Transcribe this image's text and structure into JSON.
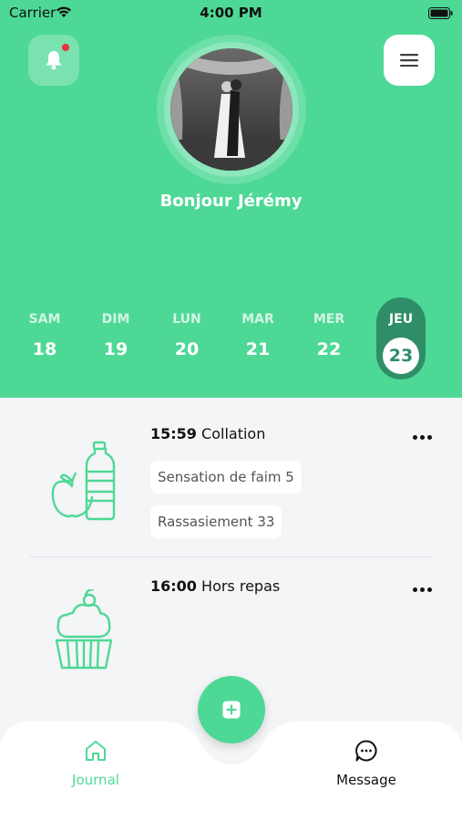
{
  "status": {
    "carrier": "Carrier",
    "time": "4:00 PM"
  },
  "header": {
    "greeting": "Bonjour Jérémy"
  },
  "days": [
    {
      "name": "SAM",
      "num": "18"
    },
    {
      "name": "DIM",
      "num": "19"
    },
    {
      "name": "LUN",
      "num": "20"
    },
    {
      "name": "MAR",
      "num": "21"
    },
    {
      "name": "MER",
      "num": "22"
    },
    {
      "name": "JEU",
      "num": "23"
    }
  ],
  "entries": [
    {
      "time": "15:59",
      "title": "Collation",
      "tags": [
        "Sensation de faim 5",
        "Rassasiement 33"
      ],
      "icon": "apple-bottle-icon"
    },
    {
      "time": "16:00",
      "title": "Hors repas",
      "tags": [],
      "icon": "cupcake-icon"
    }
  ],
  "tabbar": {
    "journal_label": "Journal",
    "message_label": "Message"
  },
  "colors": {
    "accent": "#4ED896",
    "accent_dark": "#2F8E68",
    "badge": "#E8323C"
  }
}
